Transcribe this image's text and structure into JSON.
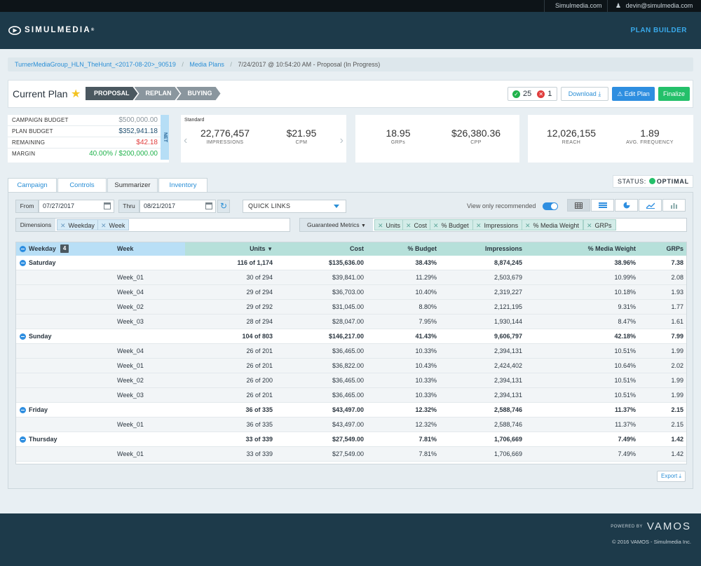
{
  "topbar": {
    "site_link": "Simulmedia.com",
    "user_email": "devin@simulmedia.com"
  },
  "header": {
    "brand": "SIMULMEDIA",
    "nav_label": "PLAN BUILDER"
  },
  "breadcrumb": {
    "items": [
      "TurnerMediaGroup_HLN_TheHunt_<2017-08-20>_90519",
      "Media Plans",
      "7/24/2017 @ 10:54:20 AM - Proposal (In Progress)"
    ],
    "separator": "/"
  },
  "plan": {
    "title": "Current Plan",
    "steps": [
      "PROPOSAL",
      "REPLAN",
      "BUYING"
    ],
    "ok_count": "25",
    "error_count": "1",
    "download_label": "Download",
    "edit_label": "Edit Plan",
    "finalize_label": "Finalize"
  },
  "budget": {
    "rows": [
      {
        "label": "CAMPAIGN BUDGET",
        "value": "$500,000.00"
      },
      {
        "label": "PLAN BUDGET",
        "value": "$352,941.18"
      },
      {
        "label": "REMAINING",
        "value": "$42.18"
      },
      {
        "label": "MARGIN",
        "value": "40.00% / $200,000.00"
      }
    ],
    "net_label": "NET"
  },
  "cards": {
    "standard_label": "Standard",
    "impressions": {
      "value": "22,776,457",
      "label": "IMPRESSIONS"
    },
    "cpm": {
      "value": "$21.95",
      "label": "CPM"
    },
    "grps": {
      "value": "18.95",
      "label": "GRPs"
    },
    "cpp": {
      "value": "$26,380.36",
      "label": "CPP"
    },
    "reach": {
      "value": "12,026,155",
      "label": "REACH"
    },
    "frequency": {
      "value": "1.89",
      "label": "AVG. FREQUENCY"
    }
  },
  "status": {
    "label": "STATUS:",
    "value": "OPTIMAL"
  },
  "tabs": [
    "Campaign",
    "Controls",
    "Summarizer",
    "Inventory"
  ],
  "filters": {
    "from_label": "From",
    "from_value": "07/27/2017",
    "thru_label": "Thru",
    "thru_value": "08/21/2017",
    "quick_links": "QUICK LINKS",
    "view_only_label": "View only recommended",
    "dimensions_label": "Dimensions",
    "dimension_chips": [
      "Weekday",
      "Week"
    ],
    "metrics_label": "Guaranteed Metrics",
    "metric_chips": [
      "Units",
      "Cost",
      "% Budget",
      "Impressions",
      "% Media Weight",
      "GRPs"
    ]
  },
  "table": {
    "headers": [
      "Weekday",
      "Week",
      "Units",
      "Cost",
      "% Budget",
      "Impressions",
      "% Media Weight",
      "GRPs"
    ],
    "weekday_count": "4",
    "rows": [
      {
        "type": "parent",
        "weekday": "Saturday",
        "week": "",
        "units": "116 of 1,174",
        "cost": "$135,636.00",
        "budget": "38.43%",
        "impressions": "8,874,245",
        "weight": "38.96%",
        "grps": "7.38"
      },
      {
        "type": "child",
        "weekday": "",
        "week": "Week_01",
        "units": "30 of 294",
        "cost": "$39,841.00",
        "budget": "11.29%",
        "impressions": "2,503,679",
        "weight": "10.99%",
        "grps": "2.08"
      },
      {
        "type": "child",
        "weekday": "",
        "week": "Week_04",
        "units": "29 of 294",
        "cost": "$36,703.00",
        "budget": "10.40%",
        "impressions": "2,319,227",
        "weight": "10.18%",
        "grps": "1.93"
      },
      {
        "type": "child",
        "weekday": "",
        "week": "Week_02",
        "units": "29 of 292",
        "cost": "$31,045.00",
        "budget": "8.80%",
        "impressions": "2,121,195",
        "weight": "9.31%",
        "grps": "1.77"
      },
      {
        "type": "child",
        "weekday": "",
        "week": "Week_03",
        "units": "28 of 294",
        "cost": "$28,047.00",
        "budget": "7.95%",
        "impressions": "1,930,144",
        "weight": "8.47%",
        "grps": "1.61"
      },
      {
        "type": "parent",
        "weekday": "Sunday",
        "week": "",
        "units": "104 of 803",
        "cost": "$146,217.00",
        "budget": "41.43%",
        "impressions": "9,606,797",
        "weight": "42.18%",
        "grps": "7.99"
      },
      {
        "type": "child",
        "weekday": "",
        "week": "Week_04",
        "units": "26 of 201",
        "cost": "$36,465.00",
        "budget": "10.33%",
        "impressions": "2,394,131",
        "weight": "10.51%",
        "grps": "1.99"
      },
      {
        "type": "child",
        "weekday": "",
        "week": "Week_01",
        "units": "26 of 201",
        "cost": "$36,822.00",
        "budget": "10.43%",
        "impressions": "2,424,402",
        "weight": "10.64%",
        "grps": "2.02"
      },
      {
        "type": "child",
        "weekday": "",
        "week": "Week_02",
        "units": "26 of 200",
        "cost": "$36,465.00",
        "budget": "10.33%",
        "impressions": "2,394,131",
        "weight": "10.51%",
        "grps": "1.99"
      },
      {
        "type": "child",
        "weekday": "",
        "week": "Week_03",
        "units": "26 of 201",
        "cost": "$36,465.00",
        "budget": "10.33%",
        "impressions": "2,394,131",
        "weight": "10.51%",
        "grps": "1.99"
      },
      {
        "type": "parent",
        "weekday": "Friday",
        "week": "",
        "units": "36 of 335",
        "cost": "$43,497.00",
        "budget": "12.32%",
        "impressions": "2,588,746",
        "weight": "11.37%",
        "grps": "2.15"
      },
      {
        "type": "child",
        "weekday": "",
        "week": "Week_01",
        "units": "36 of 335",
        "cost": "$43,497.00",
        "budget": "12.32%",
        "impressions": "2,588,746",
        "weight": "11.37%",
        "grps": "2.15"
      },
      {
        "type": "parent",
        "weekday": "Thursday",
        "week": "",
        "units": "33 of 339",
        "cost": "$27,549.00",
        "budget": "7.81%",
        "impressions": "1,706,669",
        "weight": "7.49%",
        "grps": "1.42"
      },
      {
        "type": "child",
        "weekday": "",
        "week": "Week_01",
        "units": "33 of 339",
        "cost": "$27,549.00",
        "budget": "7.81%",
        "impressions": "1,706,669",
        "weight": "7.49%",
        "grps": "1.42"
      }
    ],
    "export_label": "Export"
  },
  "footer": {
    "powered_by": "POWERED BY",
    "vamos": "VAMOS",
    "copyright": "© 2016 VAMOS - Simulmedia Inc."
  },
  "colors": {
    "header_bg": "#1d3a4a",
    "accent_blue": "#2e8ee0",
    "success_green": "#24c06a",
    "error_red": "#e03c3c",
    "star": "#f4c321"
  }
}
